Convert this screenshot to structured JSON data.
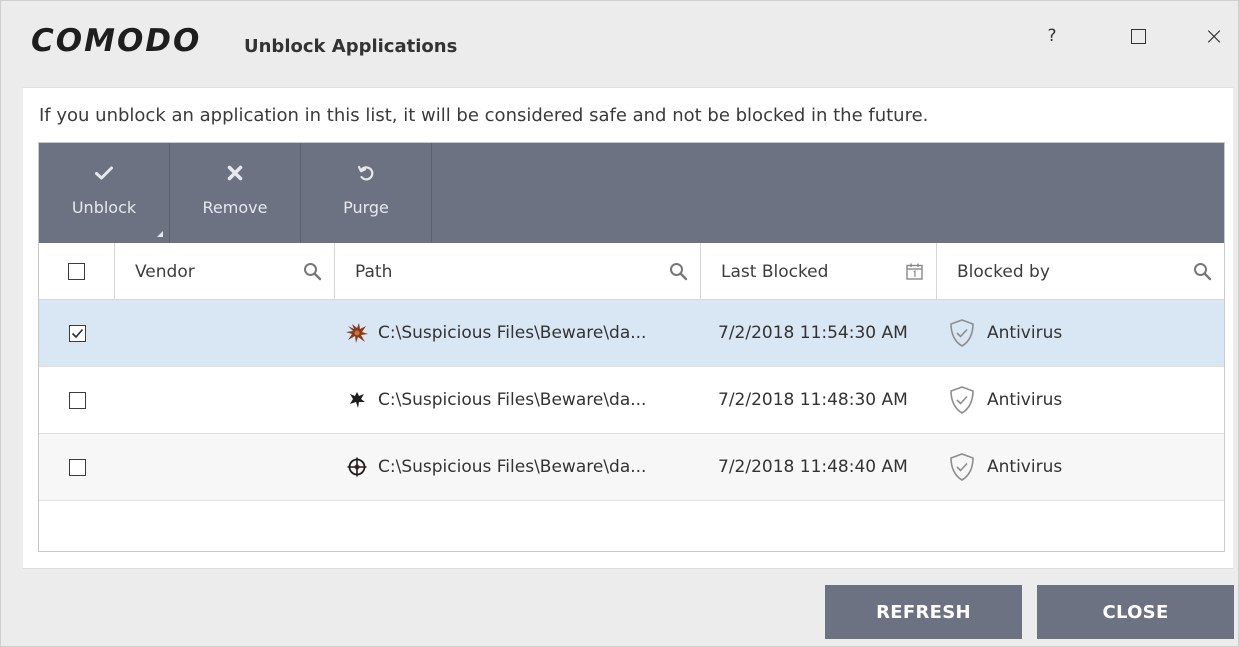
{
  "titlebar": {
    "logo": "COMODO",
    "title": "Unblock Applications",
    "help": "?",
    "close_glyph": "×"
  },
  "info_text": "If you unblock an application in this list, it will be considered safe and not be blocked in the future.",
  "toolbar": {
    "buttons": [
      {
        "label": "Unblock",
        "icon": "check-icon"
      },
      {
        "label": "Remove",
        "icon": "x-icon"
      },
      {
        "label": "Purge",
        "icon": "refresh-arrow-icon"
      }
    ]
  },
  "columns": {
    "vendor": "Vendor",
    "path": "Path",
    "last_blocked": "Last Blocked",
    "blocked_by": "Blocked by"
  },
  "rows": [
    {
      "checked": true,
      "vendor": "",
      "path": "C:\\Suspicious Files\\Beware\\da...",
      "last_blocked": "7/2/2018 11:54:30 AM",
      "blocked_by": "Antivirus",
      "icon": "malware-brown-icon"
    },
    {
      "checked": false,
      "vendor": "",
      "path": "C:\\Suspicious Files\\Beware\\da...",
      "last_blocked": "7/2/2018 11:48:30 AM",
      "blocked_by": "Antivirus",
      "icon": "malware-black-icon"
    },
    {
      "checked": false,
      "vendor": "",
      "path": "C:\\Suspicious Files\\Beware\\da...",
      "last_blocked": "7/2/2018 11:48:40 AM",
      "blocked_by": "Antivirus",
      "icon": "target-icon"
    }
  ],
  "buttons": {
    "refresh": "REFRESH",
    "close": "CLOSE"
  },
  "colors": {
    "toolbar": "#6c7282",
    "selected_row": "#d9e7f5"
  }
}
